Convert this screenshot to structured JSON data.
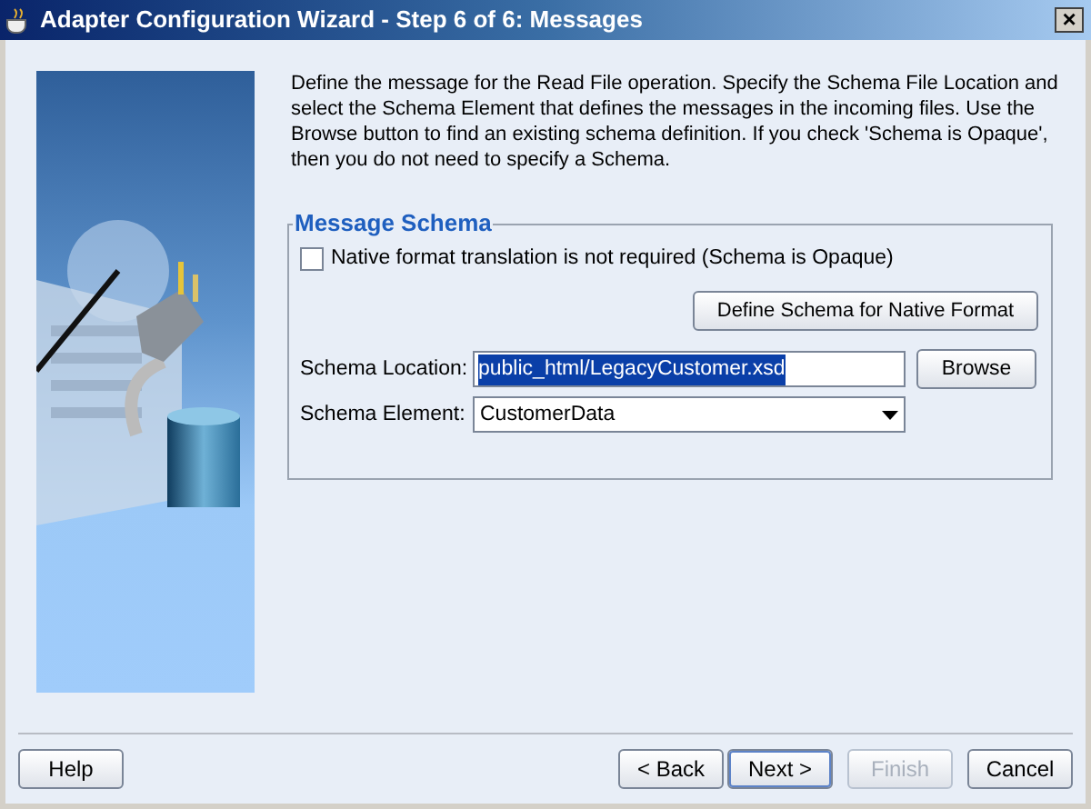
{
  "window": {
    "title": "Adapter Configuration Wizard - Step 6 of 6: Messages",
    "close": "×"
  },
  "description": "Define the message for the Read File operation.  Specify the Schema File Location and select the Schema Element that defines the messages in the incoming files. Use the Browse button to find an existing schema definition. If you check 'Schema is Opaque', then you do not need to specify a Schema.",
  "message_schema": {
    "title": "Message Schema",
    "opaque_checkbox": {
      "label": "Native format translation is not required (Schema is Opaque)",
      "checked": false
    },
    "define_button": "Define Schema for Native Format",
    "schema_location": {
      "label": "Schema Location:",
      "value": "public_html/LegacyCustomer.xsd",
      "selected_text": true
    },
    "browse_button": "Browse",
    "schema_element": {
      "label": "Schema Element:",
      "value": "CustomerData"
    }
  },
  "buttons": [
    {
      "label": "Help",
      "disabled": false,
      "focused": false
    },
    {
      "label": "< Back",
      "disabled": false,
      "focused": false
    },
    {
      "label": "Next >",
      "disabled": false,
      "focused": true
    },
    {
      "label": "Finish",
      "disabled": true,
      "focused": false
    },
    {
      "label": "Cancel",
      "disabled": false,
      "focused": false
    }
  ]
}
